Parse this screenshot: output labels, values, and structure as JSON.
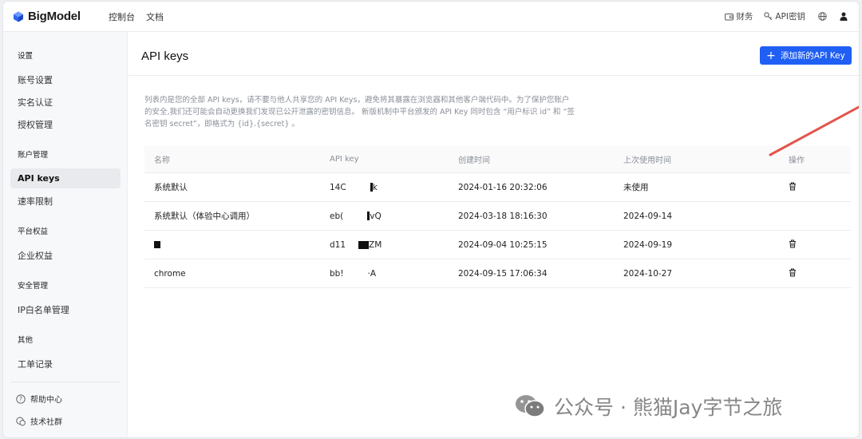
{
  "brand": {
    "name": "BigModel"
  },
  "topnav": {
    "links": [
      "控制台",
      "文档"
    ],
    "finance_label": "财务",
    "apikey_label": "API密钥"
  },
  "sidebar": {
    "groups": {
      "settings": "设置",
      "account": "账户管理",
      "benefits": "平台权益",
      "security": "安全管理",
      "other": "其他"
    },
    "items": {
      "account_settings": "账号设置",
      "realname": "实名认证",
      "auth": "授权管理",
      "api_keys": "API keys",
      "rate_limit": "速率限制",
      "enterprise": "企业权益",
      "ip_whitelist": "IP白名单管理",
      "tickets": "工单记录"
    },
    "footer": {
      "help": "帮助中心",
      "community": "技术社群"
    }
  },
  "main": {
    "title": "API keys",
    "add_button": "添加新的API Key",
    "description": "列表内是您的全部 API keys，请不要与他人共享您的 API Keys，避免将其暴露在浏览器和其他客户端代码中。为了保护您账户的安全,我们还可能会自动更换我们发现已公开泄露的密钥信息。 新版机制中平台颁发的 API Key 同时包含 “用户标识 id” 和 “签名密钥 secret”，即格式为 {id}.{secret} 。",
    "table": {
      "headers": [
        "名称",
        "API key",
        "创建时间",
        "上次使用时间",
        "操作"
      ],
      "rows": [
        {
          "name": "系统默认",
          "key_prefix": "14C",
          "key_suffix": "k",
          "created": "2024-01-16 20:32:06",
          "last_used": "未使用",
          "deletable": true
        },
        {
          "name": "系统默认（体验中心调用）",
          "key_prefix": "eb(",
          "key_suffix": "vQ",
          "created": "2024-03-18 18:16:30",
          "last_used": "2024-09-14",
          "deletable": false
        },
        {
          "name": "",
          "key_prefix": "d11",
          "key_suffix": "ZM",
          "created": "2024-09-04 10:25:15",
          "last_used": "2024-09-19",
          "deletable": true
        },
        {
          "name": "chrome",
          "key_prefix": "bb!",
          "key_suffix": "·A",
          "created": "2024-09-15 17:06:34",
          "last_used": "2024-10-27",
          "deletable": true
        }
      ]
    }
  },
  "watermark": {
    "text": "公众号 · 熊猫Jay字节之旅"
  },
  "colors": {
    "primary": "#1f5ff4",
    "arrow": "#e2544a"
  }
}
